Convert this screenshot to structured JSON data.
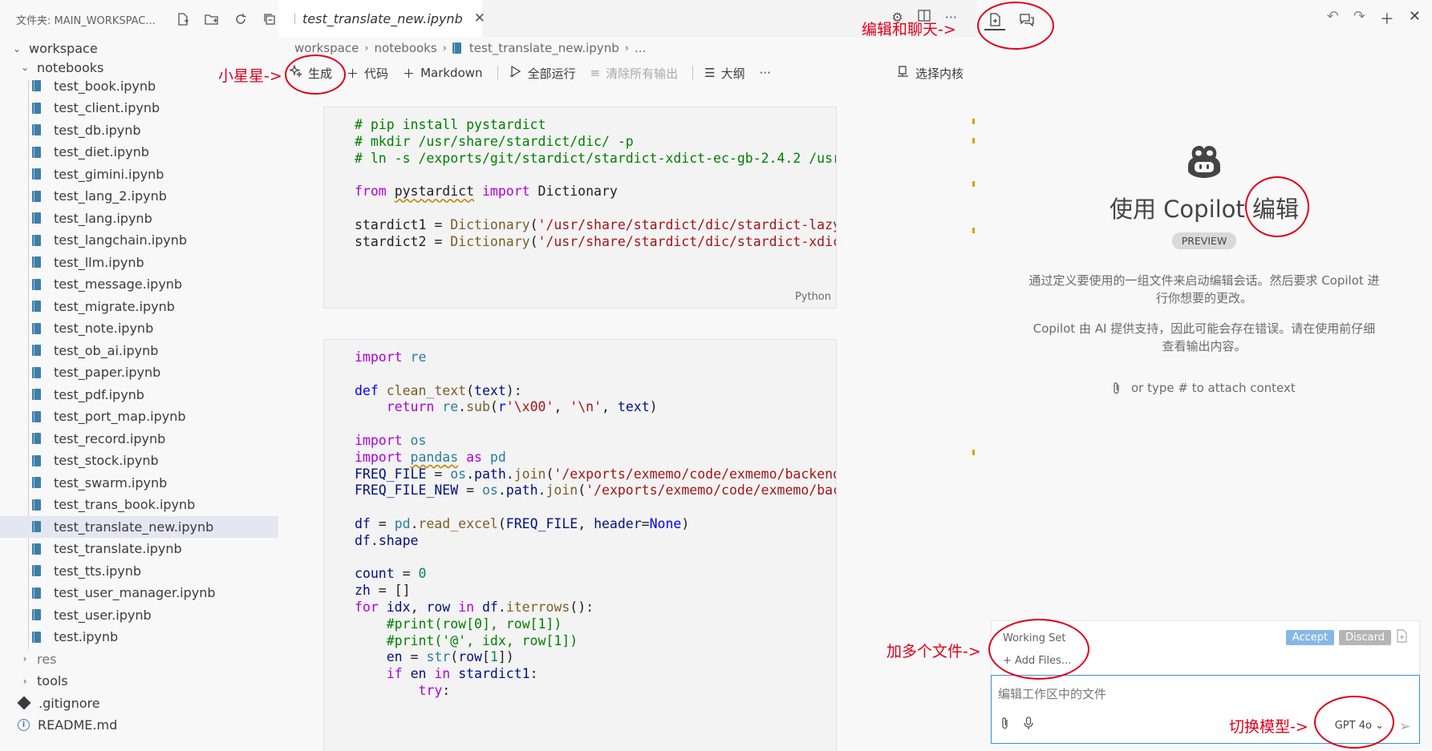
{
  "explorer": {
    "header_title": "文件夹: MAIN_WORKSPAC...",
    "root": "workspace",
    "folder": "notebooks",
    "files": [
      "test_book.ipynb",
      "test_client.ipynb",
      "test_db.ipynb",
      "test_diet.ipynb",
      "test_gimini.ipynb",
      "test_lang_2.ipynb",
      "test_lang.ipynb",
      "test_langchain.ipynb",
      "test_llm.ipynb",
      "test_message.ipynb",
      "test_migrate.ipynb",
      "test_note.ipynb",
      "test_ob_ai.ipynb",
      "test_paper.ipynb",
      "test_pdf.ipynb",
      "test_port_map.ipynb",
      "test_record.ipynb",
      "test_stock.ipynb",
      "test_swarm.ipynb",
      "test_trans_book.ipynb",
      "test_translate_new.ipynb",
      "test_translate.ipynb",
      "test_tts.ipynb",
      "test_user_manager.ipynb",
      "test_user.ipynb",
      "test.ipynb"
    ],
    "selected_index": 20,
    "folders_after": [
      "res",
      "tools"
    ],
    "root_files": [
      ".gitignore",
      "README.md"
    ]
  },
  "editor": {
    "tab_title": "test_translate_new.ipynb",
    "breadcrumb": [
      "workspace",
      "notebooks",
      "test_translate_new.ipynb",
      "..."
    ],
    "toolbar": {
      "generate": "生成",
      "code": "代码",
      "markdown": "Markdown",
      "run_all": "全部运行",
      "clear_outputs": "清除所有输出",
      "outline": "大纲",
      "more": "···",
      "select_kernel": "选择内核"
    },
    "cell1_lang": "Python"
  },
  "copilot": {
    "title": "使用 Copilot 编辑",
    "badge": "PREVIEW",
    "desc1": "通过定义要使用的一组文件来启动编辑会话。然后要求 Copilot 进行你想要的更改。",
    "desc2": "Copilot 由 AI 提供支持，因此可能会存在错误。请在使用前仔细查看输出内容。",
    "attach_hint": "or type # to attach context",
    "working_set": "Working Set",
    "add_files": "+ Add Files...",
    "accept": "Accept",
    "discard": "Discard",
    "input_placeholder": "编辑工作区中的文件",
    "model": "GPT 4o"
  },
  "annotations": {
    "edit_chat": "编辑和聊天->",
    "star": "小星星->",
    "add_files": "加多个文件->",
    "switch_model": "切换模型->"
  },
  "colors": {
    "annotation": "#e0001b",
    "accent": "#3a8fd9",
    "selected_row": "#e4e6f1"
  }
}
